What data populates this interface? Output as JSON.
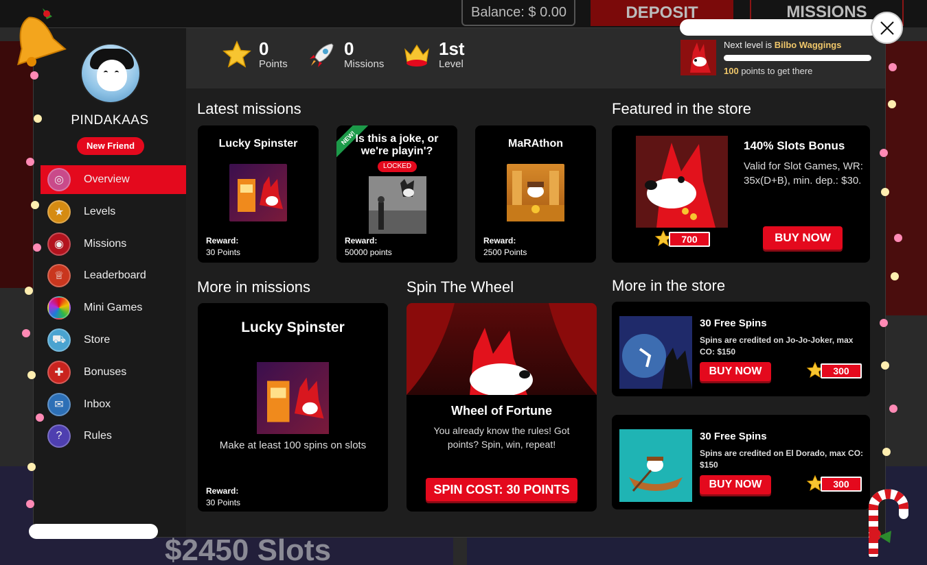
{
  "background": {
    "balance_label": "Balance: $ 0.00",
    "deposit_label": "DEPOSIT",
    "missions_label": "MISSIONS",
    "bottom_text": "$2450 Slots"
  },
  "user": {
    "name": "PINDAKAAS",
    "badge": "New Friend"
  },
  "nav": [
    {
      "label": "Overview",
      "icon": "overview-icon",
      "active": true
    },
    {
      "label": "Levels",
      "icon": "levels-icon"
    },
    {
      "label": "Missions",
      "icon": "missions-icon"
    },
    {
      "label": "Leaderboard",
      "icon": "leaderboard-icon"
    },
    {
      "label": "Mini Games",
      "icon": "mini-games-icon"
    },
    {
      "label": "Store",
      "icon": "store-icon"
    },
    {
      "label": "Bonuses",
      "icon": "bonuses-icon"
    },
    {
      "label": "Inbox",
      "icon": "inbox-icon"
    },
    {
      "label": "Rules",
      "icon": "rules-icon"
    }
  ],
  "stats": {
    "points": {
      "value": "0",
      "label": "Points"
    },
    "missions": {
      "value": "0",
      "label": "Missions"
    },
    "level": {
      "value": "1st",
      "label": "Level"
    }
  },
  "next_level": {
    "prefix": "Next level is ",
    "name": "Bilbo Waggings",
    "points": "100",
    "suffix": " points to get there",
    "progress": 0
  },
  "latest_missions": {
    "title": "Latest missions",
    "items": [
      {
        "title": "Lucky Spinster",
        "reward_label": "Reward:",
        "reward": "30 Points"
      },
      {
        "title": "Is this a joke, or we're playin'?",
        "tag": "NEW!",
        "status": "LOCKED",
        "reward_label": "Reward:",
        "reward": "50000 points"
      },
      {
        "title": "MaRAthon",
        "reward_label": "Reward:",
        "reward": "2500 Points"
      }
    ]
  },
  "featured_store": {
    "title": "Featured in the store",
    "item": {
      "title": "140% Slots Bonus",
      "description": "Valid for Slot Games, WR: 35x(D+B), min. dep.: $30.",
      "price": "700",
      "button": "BUY NOW"
    }
  },
  "more_missions": {
    "title": "More in missions",
    "item": {
      "title": "Lucky Spinster",
      "description": "Make at least 100 spins on slots",
      "reward_label": "Reward:",
      "reward": "30 Points"
    }
  },
  "spin_wheel": {
    "title": "Spin The Wheel",
    "card_title": "Wheel of Fortune",
    "description": "You already know the rules! Got points? Spin, win, repeat!",
    "button": "SPIN COST: 30 POINTS"
  },
  "more_store": {
    "title": "More in the store",
    "items": [
      {
        "title": "30 Free Spins",
        "description": "Spins are credited on Jo-Jo-Joker, max CO: $150",
        "button": "BUY NOW",
        "price": "300"
      },
      {
        "title": "30 Free Spins",
        "description": "Spins are credited on El Dorado, max CO: $150",
        "button": "BUY NOW",
        "price": "300"
      }
    ]
  },
  "colors": {
    "accent": "#e4091d",
    "gold": "#f0c76a",
    "panel": "#1e1e1e",
    "card": "#000000"
  }
}
